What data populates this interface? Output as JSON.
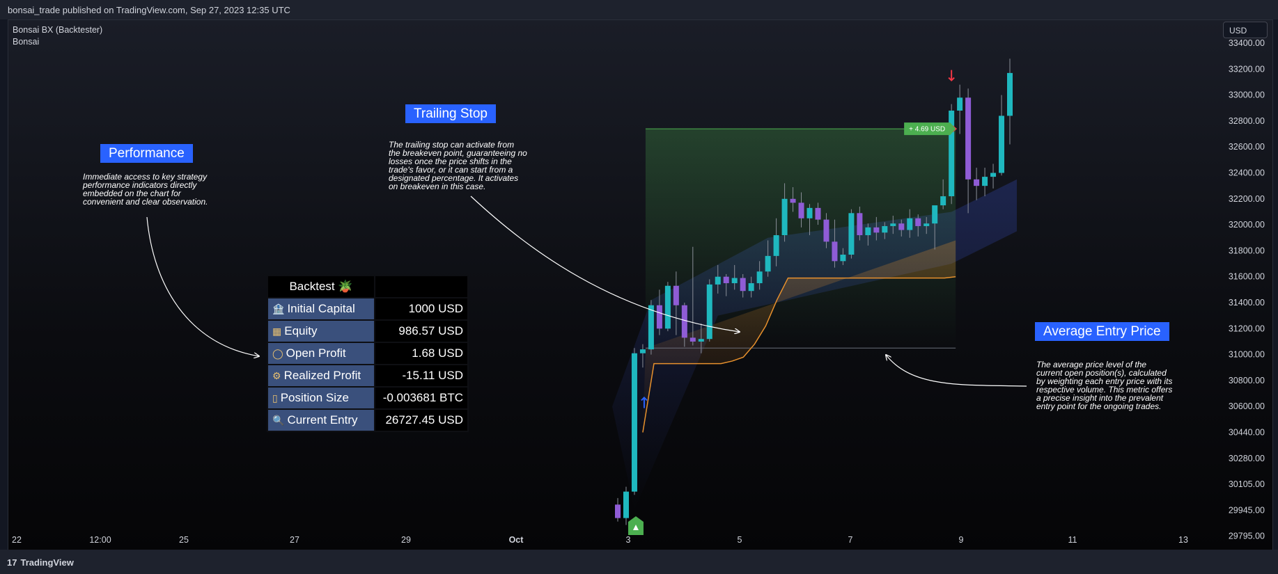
{
  "header": {
    "published": "bonsai_trade published on TradingView.com, Sep 27, 2023 12:35 UTC"
  },
  "footer": {
    "brand": "TradingView",
    "logo_glyph": "17"
  },
  "legend": {
    "indicator": "Bonsai BX (Backtester)",
    "source": "Bonsai"
  },
  "currency_button": "USD",
  "colors": {
    "bull": "#26a69a",
    "bull_body": "#1fb8bf",
    "bear": "#8f5cd6",
    "wick": "#8a8f99",
    "trail": "#e8912d",
    "callout": "#2962ff",
    "tp_green": "#4caf50",
    "signal_red": "#f23645",
    "signal_blue": "#2962ff"
  },
  "callouts": {
    "performance": {
      "title": "Performance",
      "text": [
        "Immediate access to key strategy",
        "performance indicators directly",
        "embedded on the chart for",
        "convenient and clear observation."
      ]
    },
    "trailing": {
      "title": "Trailing Stop",
      "text": [
        "The trailing stop can activate from",
        "the breakeven point, guaranteeing no",
        "losses once the price shifts in the",
        "trade's favor, or it can start from a",
        "designated percentage. It activates",
        "on breakeven in this case."
      ]
    },
    "avg_entry": {
      "title": "Average Entry Price",
      "text": [
        "The average price level of the",
        "current open position(s), calculated",
        "by weighting each entry price with its",
        "respective volume. This metric offers",
        "a precise insight into the prevalent",
        "entry point for the ongoing trades."
      ]
    }
  },
  "backtest": {
    "title": "Backtest 🪴",
    "rows": [
      {
        "icon": "🏦",
        "icon_name": "bank-icon",
        "label": "Initial Capital",
        "value": "1000 USD"
      },
      {
        "icon": "▦",
        "icon_name": "equity-bars-icon",
        "label": "Equity",
        "value": "986.57 USD"
      },
      {
        "icon": "◯",
        "icon_name": "circle-icon",
        "label": "Open Profit",
        "value": "1.68 USD"
      },
      {
        "icon": "⚙",
        "icon_name": "gear-icon",
        "label": "Realized Profit",
        "value": "-15.11 USD"
      },
      {
        "icon": "▯",
        "icon_name": "position-icon",
        "label": "Position Size",
        "value": "-0.003681 BTC"
      },
      {
        "icon": "🔍",
        "icon_name": "magnifier-icon",
        "label": "Current Entry",
        "value": "26727.45 USD"
      }
    ]
  },
  "chart_data": {
    "type": "candlestick",
    "symbol_price_axis": {
      "tick_labels": [
        "33400.00",
        "33200.00",
        "33000.00",
        "32800.00",
        "32600.00",
        "32400.00",
        "32200.00",
        "32000.00",
        "31800.00",
        "31600.00",
        "31400.00",
        "31200.00",
        "31000.00",
        "30800.00",
        "30600.00",
        "30440.00",
        "30280.00",
        "30105.00",
        "29945.00",
        "29795.00"
      ]
    },
    "time_axis": {
      "tick_labels": [
        "22",
        "12:00",
        "25",
        "27",
        "29",
        "Oct",
        "3",
        "5",
        "7",
        "9",
        "11",
        "13"
      ]
    },
    "take_profit_label": "+ 4.69 USD",
    "candles": [
      [
        29980,
        30020,
        29880,
        29900
      ],
      [
        29900,
        30090,
        29860,
        30060
      ],
      [
        30060,
        31050,
        30040,
        31010
      ],
      [
        31010,
        31080,
        30900,
        31040
      ],
      [
        31040,
        31420,
        31000,
        31380
      ],
      [
        31380,
        31500,
        31150,
        31200
      ],
      [
        31200,
        31560,
        31180,
        31530
      ],
      [
        31530,
        31640,
        31150,
        31380
      ],
      [
        31380,
        31400,
        31060,
        31130
      ],
      [
        31130,
        31830,
        31070,
        31100
      ],
      [
        31100,
        31240,
        31010,
        31120
      ],
      [
        31120,
        31580,
        31100,
        31540
      ],
      [
        31540,
        31690,
        31470,
        31600
      ],
      [
        31600,
        31620,
        31450,
        31550
      ],
      [
        31550,
        31690,
        31500,
        31590
      ],
      [
        31590,
        31620,
        31440,
        31490
      ],
      [
        31490,
        31600,
        31440,
        31550
      ],
      [
        31550,
        31720,
        31500,
        31640
      ],
      [
        31640,
        31880,
        31600,
        31760
      ],
      [
        31760,
        32050,
        31680,
        31920
      ],
      [
        31920,
        32320,
        31870,
        32200
      ],
      [
        32200,
        32290,
        32100,
        32170
      ],
      [
        32170,
        32250,
        31980,
        32050
      ],
      [
        32050,
        32160,
        31920,
        32130
      ],
      [
        32130,
        32170,
        32000,
        32040
      ],
      [
        32040,
        32090,
        31820,
        31870
      ],
      [
        31870,
        32040,
        31670,
        31720
      ],
      [
        31720,
        31820,
        31690,
        31770
      ],
      [
        31770,
        32120,
        31740,
        32090
      ],
      [
        32090,
        32140,
        31880,
        31920
      ],
      [
        31920,
        32010,
        31840,
        31980
      ],
      [
        31980,
        32060,
        31880,
        31940
      ],
      [
        31940,
        32020,
        31890,
        31990
      ],
      [
        31990,
        32070,
        31930,
        32010
      ],
      [
        32010,
        32040,
        31910,
        31960
      ],
      [
        31960,
        32120,
        31900,
        32050
      ],
      [
        32050,
        32080,
        31910,
        31990
      ],
      [
        31990,
        32060,
        31930,
        32010
      ],
      [
        32010,
        32140,
        31810,
        32150
      ],
      [
        32150,
        32350,
        32120,
        32220
      ],
      [
        32220,
        32930,
        32160,
        32880
      ],
      [
        32880,
        33080,
        32700,
        32980
      ],
      [
        32980,
        33050,
        32090,
        32350
      ],
      [
        32350,
        32440,
        32190,
        32300
      ],
      [
        32300,
        32440,
        32220,
        32370
      ],
      [
        32370,
        32470,
        32280,
        32400
      ],
      [
        32400,
        33000,
        32380,
        32840
      ],
      [
        32840,
        33280,
        32620,
        33170
      ]
    ],
    "trailing_stop": [
      30440,
      30930,
      30930,
      30930,
      30930,
      30930,
      30930,
      30930,
      30950,
      30980,
      31080,
      31220,
      31420,
      31590,
      31590,
      31590,
      31590,
      31590,
      31590,
      31590,
      31590,
      31590,
      31590,
      31590,
      31590,
      31590,
      31590,
      31590,
      31600
    ],
    "average_entry_price": 31050,
    "take_profit_price": 32740
  }
}
